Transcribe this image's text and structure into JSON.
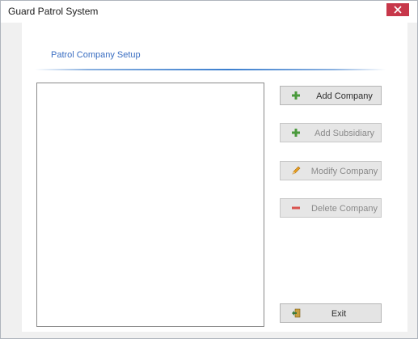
{
  "window": {
    "title": "Guard Patrol System",
    "close_icon": "close-icon",
    "close_color": "#c7374a"
  },
  "section": {
    "title": "Patrol Company Setup"
  },
  "company_list": {
    "items": []
  },
  "buttons": {
    "add_company": {
      "label": "Add Company",
      "icon": "plus-icon",
      "enabled": true
    },
    "add_subsidiary": {
      "label": "Add Subsidiary",
      "icon": "plus-icon",
      "enabled": false
    },
    "modify_company": {
      "label": "Modify Company",
      "icon": "pencil-icon",
      "enabled": false
    },
    "delete_company": {
      "label": "Delete Company",
      "icon": "minus-icon",
      "enabled": false
    },
    "exit": {
      "label": "Exit",
      "icon": "exit-door-icon",
      "enabled": true
    }
  },
  "colors": {
    "accent_blue": "#3a6ec2",
    "plus_green": "#4a9a3c",
    "minus_red": "#d9534f",
    "pencil_orange": "#e8a020"
  }
}
